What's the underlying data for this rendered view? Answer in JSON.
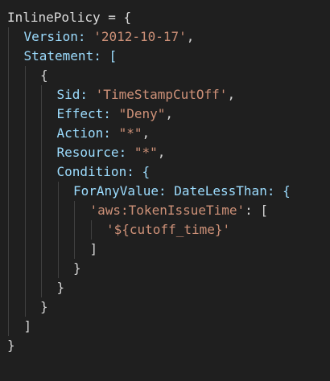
{
  "code": {
    "lines": [
      {
        "indent": 0,
        "tokens": [
          {
            "t": "InlinePolicy = {",
            "c": "var"
          }
        ]
      },
      {
        "indent": 1,
        "tokens": [
          {
            "t": "Version: ",
            "c": "key"
          },
          {
            "t": "'2012-10-17'",
            "c": "str"
          },
          {
            "t": ",",
            "c": "punc"
          }
        ]
      },
      {
        "indent": 1,
        "tokens": [
          {
            "t": "Statement: [",
            "c": "key"
          }
        ]
      },
      {
        "indent": 2,
        "tokens": [
          {
            "t": "{",
            "c": "punc"
          }
        ]
      },
      {
        "indent": 3,
        "tokens": [
          {
            "t": "Sid: ",
            "c": "key"
          },
          {
            "t": "'TimeStampCutOff'",
            "c": "str"
          },
          {
            "t": ",",
            "c": "punc"
          }
        ]
      },
      {
        "indent": 3,
        "tokens": [
          {
            "t": "Effect: ",
            "c": "key"
          },
          {
            "t": "\"Deny\"",
            "c": "str"
          },
          {
            "t": ",",
            "c": "punc"
          }
        ]
      },
      {
        "indent": 3,
        "tokens": [
          {
            "t": "Action: ",
            "c": "key"
          },
          {
            "t": "\"*\"",
            "c": "str"
          },
          {
            "t": ",",
            "c": "punc"
          }
        ]
      },
      {
        "indent": 3,
        "tokens": [
          {
            "t": "Resource: ",
            "c": "key"
          },
          {
            "t": "\"*\"",
            "c": "str"
          },
          {
            "t": ",",
            "c": "punc"
          }
        ]
      },
      {
        "indent": 3,
        "tokens": [
          {
            "t": "Condition: {",
            "c": "key"
          }
        ]
      },
      {
        "indent": 4,
        "tokens": [
          {
            "t": "ForAnyValue: DateLessThan: {",
            "c": "key"
          }
        ]
      },
      {
        "indent": 5,
        "tokens": [
          {
            "t": "'aws:TokenIssueTime'",
            "c": "str"
          },
          {
            "t": ": [",
            "c": "punc"
          }
        ]
      },
      {
        "indent": 6,
        "tokens": [
          {
            "t": "'${cutoff_time}'",
            "c": "str"
          }
        ]
      },
      {
        "indent": 5,
        "tokens": [
          {
            "t": "]",
            "c": "punc"
          }
        ]
      },
      {
        "indent": 4,
        "tokens": [
          {
            "t": "}",
            "c": "punc"
          }
        ]
      },
      {
        "indent": 3,
        "tokens": [
          {
            "t": "}",
            "c": "punc"
          }
        ]
      },
      {
        "indent": 2,
        "tokens": [
          {
            "t": "}",
            "c": "punc"
          }
        ]
      },
      {
        "indent": 1,
        "tokens": [
          {
            "t": "]",
            "c": "punc"
          }
        ]
      },
      {
        "indent": 0,
        "tokens": [
          {
            "t": "}",
            "c": "punc"
          }
        ]
      }
    ]
  },
  "colors": {
    "background": "#1f1f1f",
    "text": "#d4d4d4",
    "key": "#9cdcfe",
    "string": "#ce9178",
    "indent_guide": "#404040"
  }
}
